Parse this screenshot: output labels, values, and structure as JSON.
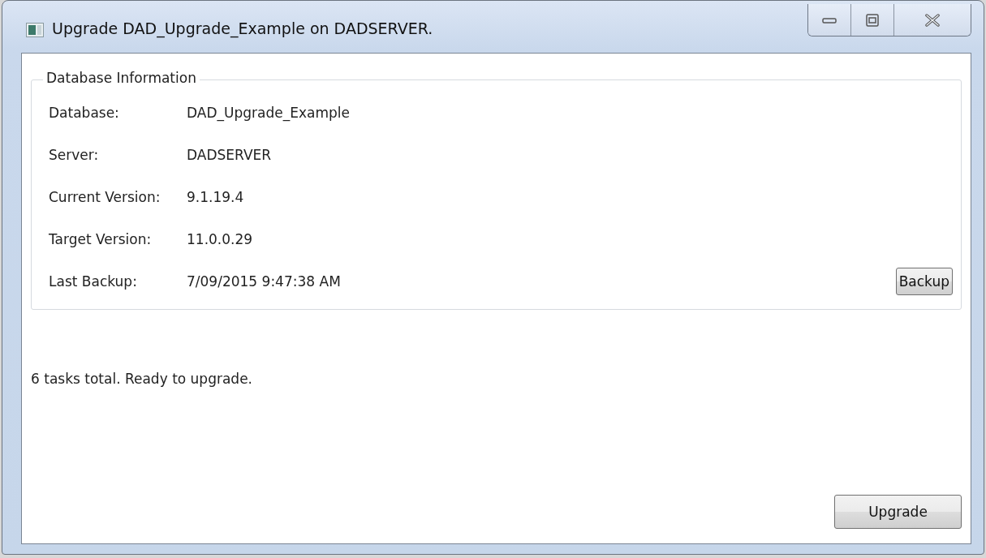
{
  "window": {
    "title": "Upgrade DAD_Upgrade_Example on DADSERVER."
  },
  "group": {
    "title": "Database Information",
    "fields": [
      {
        "label": "Database:",
        "value": "DAD_Upgrade_Example"
      },
      {
        "label": "Server:",
        "value": "DADSERVER"
      },
      {
        "label": "Current Version:",
        "value": "9.1.19.4"
      },
      {
        "label": "Target Version:",
        "value": "11.0.0.29"
      },
      {
        "label": "Last Backup:",
        "value": "7/09/2015 9:47:38 AM"
      }
    ],
    "button": "Backup"
  },
  "status": "6 tasks total. Ready to upgrade.",
  "button": "Upgrade"
}
